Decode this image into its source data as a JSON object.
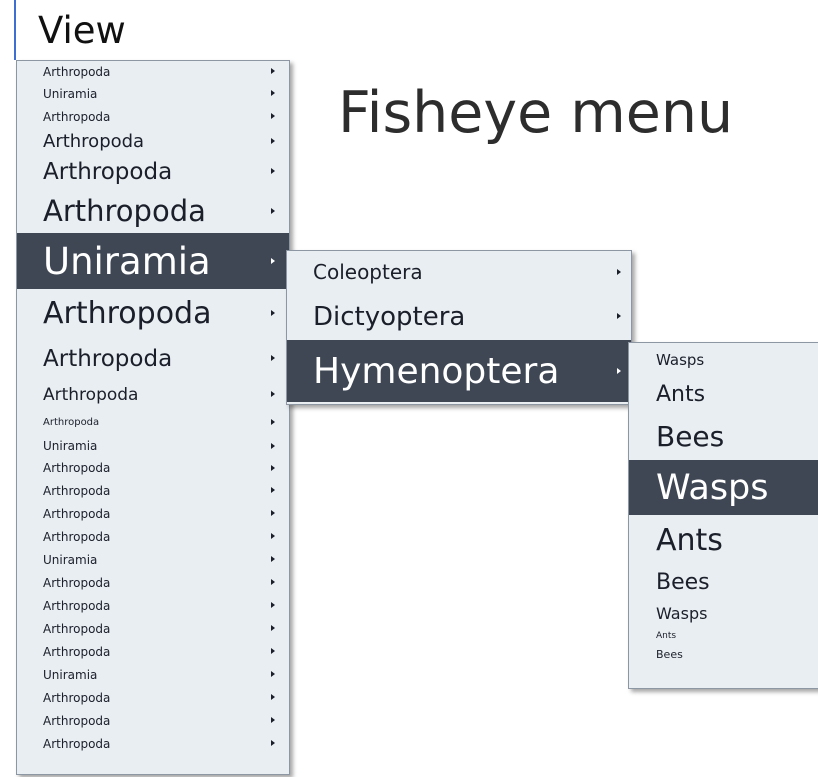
{
  "view_menu_label": "View",
  "page_title": "Fisheye menu",
  "colors": {
    "selected_bg": "#3f4755",
    "menu_bg": "#e9eef3",
    "text": "#1b1f2a"
  },
  "menu_level_1": {
    "items": [
      {
        "label": "Arthropoda",
        "has_submenu": true
      },
      {
        "label": "Uniramia",
        "has_submenu": true
      },
      {
        "label": "Arthropoda",
        "has_submenu": true
      },
      {
        "label": "Arthropoda",
        "has_submenu": true
      },
      {
        "label": "Arthropoda",
        "has_submenu": true
      },
      {
        "label": "Arthropoda",
        "has_submenu": true
      },
      {
        "label": "Uniramia",
        "has_submenu": true,
        "selected": true
      },
      {
        "label": "Arthropoda",
        "has_submenu": true
      },
      {
        "label": "Arthropoda",
        "has_submenu": true
      },
      {
        "label": "Arthropoda",
        "has_submenu": true
      },
      {
        "label": "Arthropoda",
        "has_submenu": true
      },
      {
        "label": "Uniramia",
        "has_submenu": true
      },
      {
        "label": "Arthropoda",
        "has_submenu": true
      },
      {
        "label": "Arthropoda",
        "has_submenu": true
      },
      {
        "label": "Arthropoda",
        "has_submenu": true
      },
      {
        "label": "Arthropoda",
        "has_submenu": true
      },
      {
        "label": "Uniramia",
        "has_submenu": true
      },
      {
        "label": "Arthropoda",
        "has_submenu": true
      },
      {
        "label": "Arthropoda",
        "has_submenu": true
      },
      {
        "label": "Arthropoda",
        "has_submenu": true
      },
      {
        "label": "Arthropoda",
        "has_submenu": true
      },
      {
        "label": "Uniramia",
        "has_submenu": true
      },
      {
        "label": "Arthropoda",
        "has_submenu": true
      },
      {
        "label": "Arthropoda",
        "has_submenu": true
      },
      {
        "label": "Arthropoda",
        "has_submenu": true
      }
    ]
  },
  "menu_level_2": {
    "items": [
      {
        "label": "Coleoptera",
        "has_submenu": true
      },
      {
        "label": "Dictyoptera",
        "has_submenu": true
      },
      {
        "label": "Hymenoptera",
        "has_submenu": true,
        "selected": true
      }
    ]
  },
  "menu_level_3": {
    "items": [
      {
        "label": "Wasps",
        "has_submenu": false
      },
      {
        "label": "Ants",
        "has_submenu": false
      },
      {
        "label": "Bees",
        "has_submenu": false
      },
      {
        "label": "Wasps",
        "has_submenu": false,
        "selected": true
      },
      {
        "label": "Ants",
        "has_submenu": false
      },
      {
        "label": "Bees",
        "has_submenu": false
      },
      {
        "label": "Wasps",
        "has_submenu": false
      },
      {
        "label": "Ants",
        "has_submenu": false
      },
      {
        "label": "Bees",
        "has_submenu": false
      }
    ]
  }
}
